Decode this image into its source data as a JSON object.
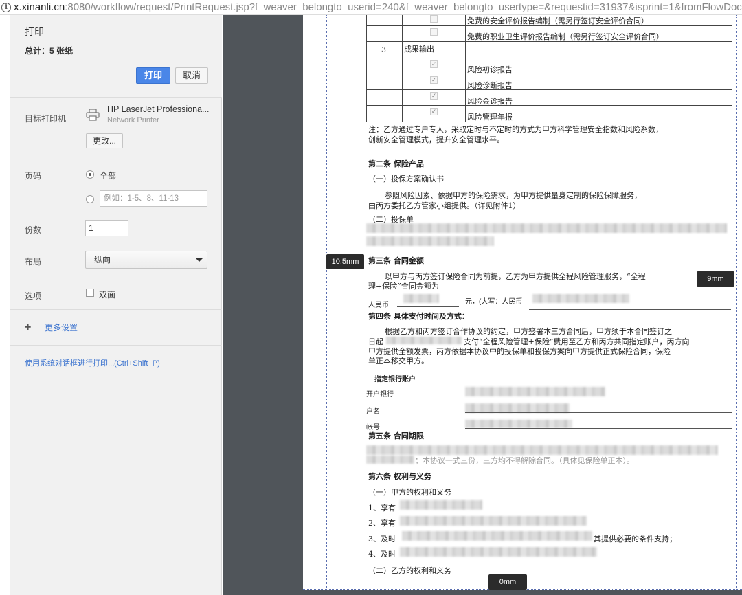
{
  "url": {
    "host": "x.xinanli.cn",
    "rest": ":8080/workflow/request/PrintRequest.jsp?f_weaver_belongto_userid=240&f_weaver_belongto_usertype=&requestid=31937&isprint=1&fromFlowDoc"
  },
  "panel": {
    "title": "打印",
    "total": "总计：5 张纸",
    "print_label": "打印",
    "cancel_label": "取消",
    "destination_label": "目标打印机",
    "printer_name": "HP LaserJet Professiona...",
    "printer_sub": "Network Printer",
    "change_label": "更改...",
    "pages_label": "页码",
    "pages_all": "全部",
    "pages_placeholder": "例如：1-5、8、11-13",
    "copies_label": "份数",
    "copies_value": "1",
    "layout_label": "布局",
    "layout_value": "纵向",
    "options_label": "选项",
    "duplex_label": "双面",
    "more_settings": "更多设置",
    "system_dialog": "使用系统对话框进行打印...(Ctrl+Shift+P)"
  },
  "margins": {
    "left": "10.5mm",
    "right": "9mm",
    "bottom": "0mm"
  },
  "document": {
    "table": {
      "row1": "免费的安全评价报告编制（需另行签订安全评价合同）",
      "row2": "免费的职业卫生评价报告编制（需另行签订安全评价合同）",
      "row3_num": "3",
      "row3_title": "成果输出",
      "items": [
        "风险初诊报告",
        "风险诊断报告",
        "风险会诊报告",
        "风险管理年报"
      ]
    },
    "note1": "注：乙方通过专户专人，采取定时与不定时的方式为甲方科学管理安全指数和风险系数，",
    "note2": "创新安全管理模式，提升安全管理水平。",
    "art2": "第二条 保险产品",
    "art2_1": "（一）投保方案确认书",
    "art2_1_p1": "参照风险因素、依据甲方的保险需求，为甲方提供量身定制的保险保障服务，",
    "art2_1_p2": "由丙方委托乙方管家小组提供。（详见附件1）",
    "art2_2": "（二）投保单",
    "art3": "第三条 合同金额",
    "art3_p1": "以甲方与丙方签订保险合同为前提，乙方为甲方提供全程风险管理服务，“全程",
    "art3_p2": "理+保险”合同金额为",
    "rmb": "人民币",
    "yuan": "元，(大写：人民币",
    "art4": "第四条 具体支付时间及方式：",
    "art4_p1": "根据乙方和丙方签订合作协议的约定，甲方签署本三方合同后，甲方须于本合同签订之",
    "art4_p2a": "日起",
    "art4_p2b": "支付“全程风险管理+保险”费用至乙方和丙方共同指定账户，丙方向",
    "art4_p3": "甲方提供全额发票，丙方依据本协议中的投保单和投保方案向甲方提供正式保险合同，保险",
    "art4_p4": "单正本移交甲方。",
    "bank_title": "指定银行账户",
    "bank_name": "开户银行",
    "account_name": "户名",
    "account_no": "帐号",
    "art5": "第五条 合同期限",
    "art5_p2": "；本协议一式三份，三方均不得解除合同。（具体见保险单正本）。",
    "art6": "第六条 权利与义务",
    "art6_1": "（一）甲方的权利和义务",
    "art6_i1": "1、享有",
    "art6_i2": "2、享有",
    "art6_i3a": "3、及时",
    "art6_i3b": "其提供必要的条件支持；",
    "art6_i4": "4、及时",
    "art6_2": "（二）乙方的权利和义务"
  }
}
